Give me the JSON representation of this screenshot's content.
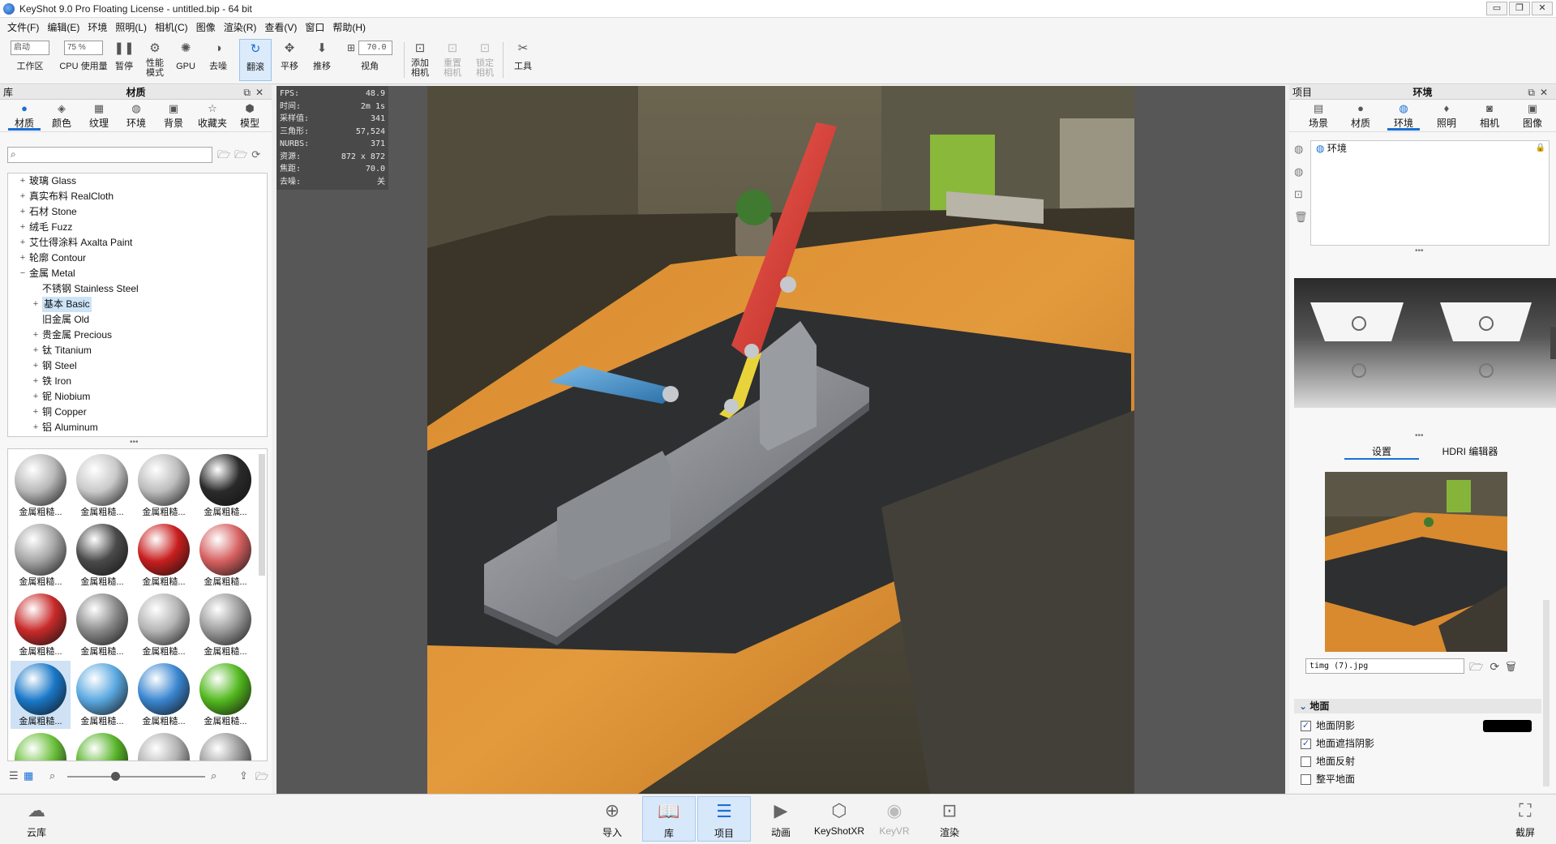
{
  "window": {
    "title": "KeyShot 9.0 Pro Floating License  - untitled.bip  - 64 bit",
    "controls": [
      "▭",
      "❐",
      "✕"
    ]
  },
  "menu": [
    "文件(F)",
    "编辑(E)",
    "环境",
    "照明(L)",
    "相机(C)",
    "图像",
    "渲染(R)",
    "查看(V)",
    "窗口",
    "帮助(H)"
  ],
  "toolbar": {
    "workspace_value": "启动",
    "workspace_label": "工作区",
    "cpu_value": "75 %",
    "cpu_label": "CPU 使用量",
    "pause_label": "暂停",
    "perf_label": "性能模式",
    "gpu_label": "GPU",
    "denoise_label": "去噪",
    "tumble_label": "翻滚",
    "pan_label": "平移",
    "dolly_label": "推移",
    "fov_value": "70.0",
    "fov_label": "视角",
    "add_camera_label": "添加相机",
    "reset_camera_label": "重置相机",
    "lock_camera_label": "锁定相机",
    "tools_label": "工具"
  },
  "library": {
    "panel_label": "库",
    "title": "材质",
    "tabs": [
      "材质",
      "颜色",
      "纹理",
      "环境",
      "背景",
      "收藏夹",
      "模型"
    ],
    "active_tab": 0,
    "search_placeholder": "",
    "tree": [
      {
        "label": "玻璃 Glass",
        "level": 0,
        "exp": "+"
      },
      {
        "label": "真实布料 RealCloth",
        "level": 0,
        "exp": "+"
      },
      {
        "label": "石材 Stone",
        "level": 0,
        "exp": "+"
      },
      {
        "label": "绒毛 Fuzz",
        "level": 0,
        "exp": "+"
      },
      {
        "label": "艾仕得涂料 Axalta Paint",
        "level": 0,
        "exp": "+"
      },
      {
        "label": "轮廓 Contour",
        "level": 0,
        "exp": "+"
      },
      {
        "label": "金属 Metal",
        "level": 0,
        "exp": "−"
      },
      {
        "label": "不锈钢 Stainless Steel",
        "level": 1,
        "exp": ""
      },
      {
        "label": "基本 Basic",
        "level": 1,
        "exp": "+",
        "selected": true
      },
      {
        "label": "旧金属 Old",
        "level": 1,
        "exp": ""
      },
      {
        "label": "贵金属 Precious",
        "level": 1,
        "exp": "+"
      },
      {
        "label": "钛 Titanium",
        "level": 1,
        "exp": "+"
      },
      {
        "label": "钢 Steel",
        "level": 1,
        "exp": "+"
      },
      {
        "label": "铁 Iron",
        "level": 1,
        "exp": "+"
      },
      {
        "label": "铌 Niobium",
        "level": 1,
        "exp": "+"
      },
      {
        "label": "铜 Copper",
        "level": 1,
        "exp": "+"
      },
      {
        "label": "铝 Aluminum",
        "level": 1,
        "exp": "+"
      }
    ],
    "thumbnails": [
      {
        "label": "金属粗糙...",
        "color": "#b8b8b8"
      },
      {
        "label": "金属粗糙...",
        "color": "#c9c9c9"
      },
      {
        "label": "金属粗糙...",
        "color": "#bdbdbd"
      },
      {
        "label": "金属粗糙...",
        "color": "#2a2a2a"
      },
      {
        "label": "金属粗糙...",
        "color": "#a5a5a5"
      },
      {
        "label": "金属粗糙...",
        "color": "#4a4a4a"
      },
      {
        "label": "金属粗糙...",
        "color": "#c81e1e"
      },
      {
        "label": "金属粗糙...",
        "color": "#d66060"
      },
      {
        "label": "金属粗糙...",
        "color": "#c82a2a"
      },
      {
        "label": "金属粗糙...",
        "color": "#8a8a8a"
      },
      {
        "label": "金属粗糙...",
        "color": "#b4b4b4"
      },
      {
        "label": "金属粗糙...",
        "color": "#9c9c9c"
      },
      {
        "label": "金属粗糙...",
        "color": "#1a78c8",
        "selected": true
      },
      {
        "label": "金属粗糙...",
        "color": "#5aa8e0"
      },
      {
        "label": "金属粗糙...",
        "color": "#3a86d0"
      },
      {
        "label": "金属粗糙...",
        "color": "#52b81e"
      },
      {
        "label": "",
        "color": "#6abf3a"
      },
      {
        "label": "",
        "color": "#58b42a"
      },
      {
        "label": "",
        "color": "#b0b0b0"
      },
      {
        "label": "",
        "color": "#9a9a9a"
      }
    ]
  },
  "stats": [
    {
      "k": "FPS:",
      "v": "48.9"
    },
    {
      "k": "时间:",
      "v": "2m 1s"
    },
    {
      "k": "采样值:",
      "v": "341"
    },
    {
      "k": "三角形:",
      "v": "57,524"
    },
    {
      "k": "NURBS:",
      "v": "371"
    },
    {
      "k": "资源:",
      "v": "872 x 872"
    },
    {
      "k": "焦距:",
      "v": "70.0"
    },
    {
      "k": "去噪:",
      "v": "关"
    }
  ],
  "project": {
    "panel_label": "项目",
    "title": "环境",
    "tabs": [
      "场景",
      "材质",
      "环境",
      "照明",
      "相机",
      "图像"
    ],
    "active_tab": 2,
    "env_item": "环境",
    "subtabs": [
      "设置",
      "HDRI 编辑器"
    ],
    "active_subtab": 0,
    "env_file": "timg (7).jpg",
    "ground_section": "地面",
    "ground_options": [
      {
        "label": "地面阴影",
        "checked": true
      },
      {
        "label": "地面遮挡阴影",
        "checked": true
      },
      {
        "label": "地面反射",
        "checked": false
      },
      {
        "label": "整平地面",
        "checked": false
      }
    ],
    "ground_shadow_color": "#000000"
  },
  "bottom": {
    "cloud_label": "云库",
    "buttons": [
      {
        "label": "导入",
        "active": false,
        "dim": false
      },
      {
        "label": "库",
        "active": true,
        "dim": false
      },
      {
        "label": "项目",
        "active": true,
        "dim": false
      },
      {
        "label": "动画",
        "active": false,
        "dim": false
      },
      {
        "label": "KeyShotXR",
        "active": false,
        "dim": false
      },
      {
        "label": "KeyVR",
        "active": false,
        "dim": true
      },
      {
        "label": "渲染",
        "active": false,
        "dim": false
      }
    ],
    "screenshot_label": "截屏"
  },
  "colors": {
    "accent": "#1a6fd6",
    "handle_red": "#e0463f",
    "link_yellow": "#e8d43a",
    "lever_blue": "#3d8fd0"
  }
}
